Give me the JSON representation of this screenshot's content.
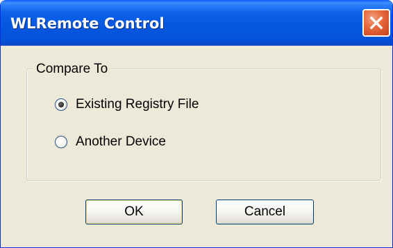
{
  "window": {
    "title": "WLRemote Control"
  },
  "titlebar": {
    "close_icon": "close-icon",
    "close_color": "#e0552c",
    "gradient_color": "#0a5fe8"
  },
  "groupbox": {
    "legend": "Compare To",
    "options": [
      {
        "label": "Existing Registry File",
        "selected": true
      },
      {
        "label": "Another Device",
        "selected": false
      }
    ]
  },
  "buttons": {
    "ok_label": "OK",
    "cancel_label": "Cancel"
  },
  "colors": {
    "dialog_background": "#ece9d8",
    "titlebar_blue": "#0a5fe8"
  }
}
